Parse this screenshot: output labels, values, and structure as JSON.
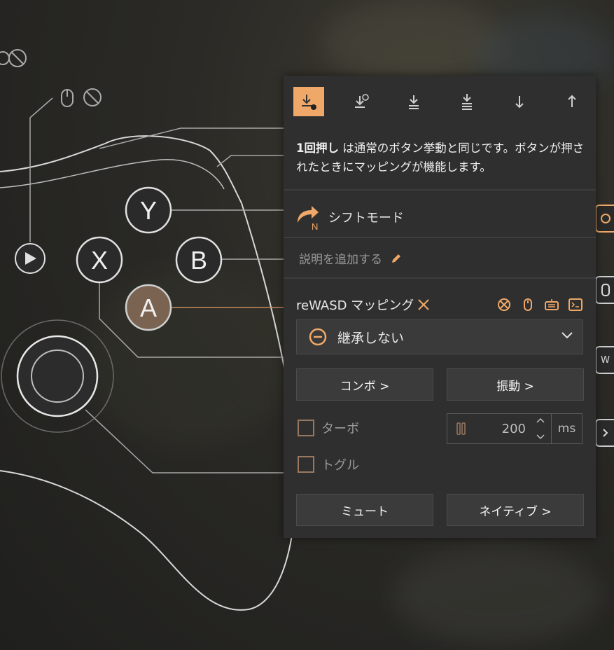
{
  "accent": "#f0a868",
  "controller": {
    "buttons": {
      "y": "Y",
      "x": "X",
      "b": "B",
      "a": "A"
    }
  },
  "panel": {
    "tabs": [
      {
        "name": "single-press-icon",
        "active": true
      },
      {
        "name": "long-press-icon",
        "active": false
      },
      {
        "name": "double-press-icon",
        "active": false
      },
      {
        "name": "triple-press-icon",
        "active": false
      },
      {
        "name": "down-icon",
        "active": false
      },
      {
        "name": "up-icon",
        "active": false
      }
    ],
    "desc_bold": "1回押し",
    "desc_rest": " は通常のボタン挙動と同じです。ボタンが押されたときにマッピングが機能します。",
    "shift_badge": "N",
    "shift_label": "シフトモード",
    "add_desc": "説明を追加する",
    "mapping_title": "reWASD マッピング",
    "dropdown_value": "継承しない",
    "combo_btn": "コンボ >",
    "vibration_btn": "振動 >",
    "turbo_label": "ターボ",
    "toggle_label": "トグル",
    "turbo_value": "200",
    "turbo_unit": "ms",
    "mute_btn": "ミュート",
    "native_btn": "ネイティブ >",
    "side_tab_w": "W"
  }
}
